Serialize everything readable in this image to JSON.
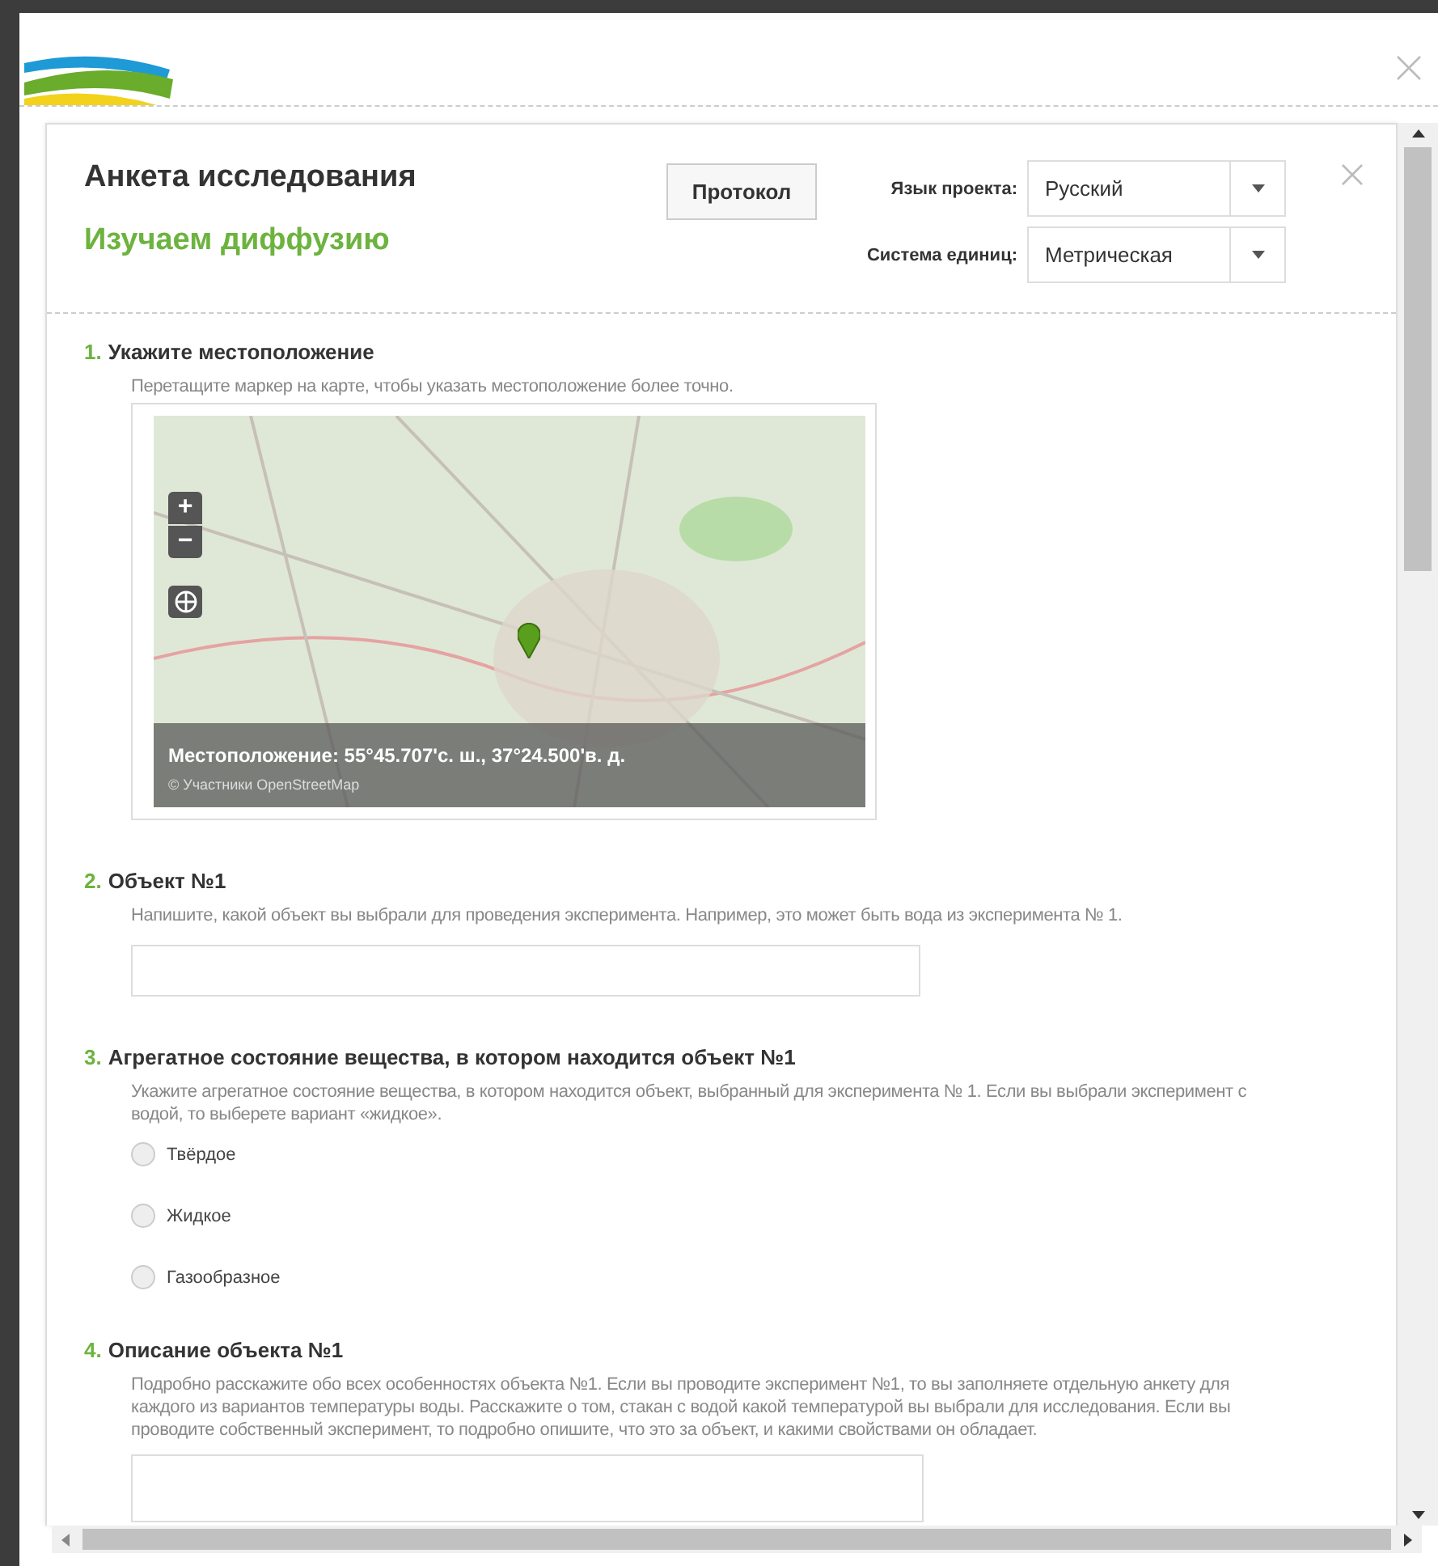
{
  "header": {
    "title": "Анкета исследования",
    "subtitle": "Изучаем диффузию",
    "protocol_button": "Протокол"
  },
  "settings": [
    {
      "label": "Язык проекта:",
      "value": "Русский"
    },
    {
      "label": "Система единиц:",
      "value": "Метрическая"
    }
  ],
  "questions": [
    {
      "kind": "map",
      "number": "1.",
      "title": "Укажите местоположение",
      "description": "Перетащите маркер на карте, чтобы указать местоположение более точно.",
      "map": {
        "zoom_in": "+",
        "zoom_out": "−",
        "location": "Местоположение: 55°45.707'с. ш., 37°24.500'в. д.",
        "attribution": "© Участники OpenStreetMap"
      }
    },
    {
      "kind": "text",
      "number": "2.",
      "title": "Объект №1",
      "description": "Напишите, какой объект вы выбрали для проведения эксперимента. Например, это может быть вода из эксперимента № 1."
    },
    {
      "kind": "radio",
      "number": "3.",
      "title": "Агрегатное состояние вещества, в котором находится объект №1",
      "description": "Укажите агрегатное состояние вещества, в котором находится объект, выбранный для эксперимента № 1. Если вы выбрали эксперимент с водой, то выберете вариант «жидкое».",
      "options": [
        {
          "label": "Твёрдое",
          "selected": false
        },
        {
          "label": "Жидкое",
          "selected": false
        },
        {
          "label": "Газообразное",
          "selected": false
        }
      ]
    },
    {
      "kind": "textarea",
      "number": "4.",
      "title": "Описание объекта №1",
      "description": "Подробно расскажите обо всех особенностях объекта №1. Если вы проводите эксперимент №1, то вы заполняете отдельную анкету для каждого из вариантов температуры воды. Расскажите о том, стакан с водой какой температурой вы выбрали для исследования. Если вы проводите собственный эксперимент, то подробно опишите, что это за объект, и какими свойствами он обладает."
    }
  ]
}
